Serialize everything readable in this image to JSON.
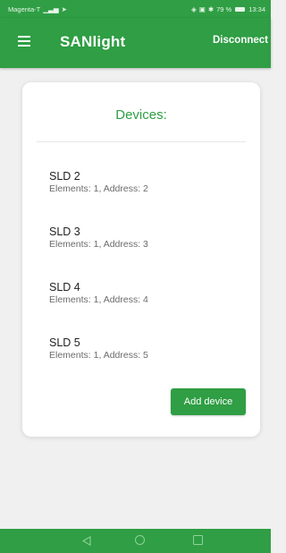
{
  "status_bar": {
    "carrier": "Magenta-T",
    "battery_percent": "79 %",
    "time": "13:34",
    "background_color": "#2f9e44"
  },
  "app_bar": {
    "title": "SANlight",
    "disconnect_label": "Disconnect",
    "menu_icon": "hamburger-menu-icon",
    "background_color": "#2f9e44"
  },
  "card": {
    "title": "Devices:",
    "devices": [
      {
        "name": "SLD 2",
        "details": "Elements: 1, Address: 2"
      },
      {
        "name": "SLD 3",
        "details": "Elements: 1, Address: 3"
      },
      {
        "name": "SLD 4",
        "details": "Elements: 1, Address: 4"
      },
      {
        "name": "SLD 5",
        "details": "Elements: 1, Address: 5"
      }
    ],
    "add_device_label": "Add device",
    "accent_color": "#2f9e44"
  },
  "nav_bar": {
    "icons": [
      "back-icon",
      "home-icon",
      "recents-icon"
    ]
  }
}
